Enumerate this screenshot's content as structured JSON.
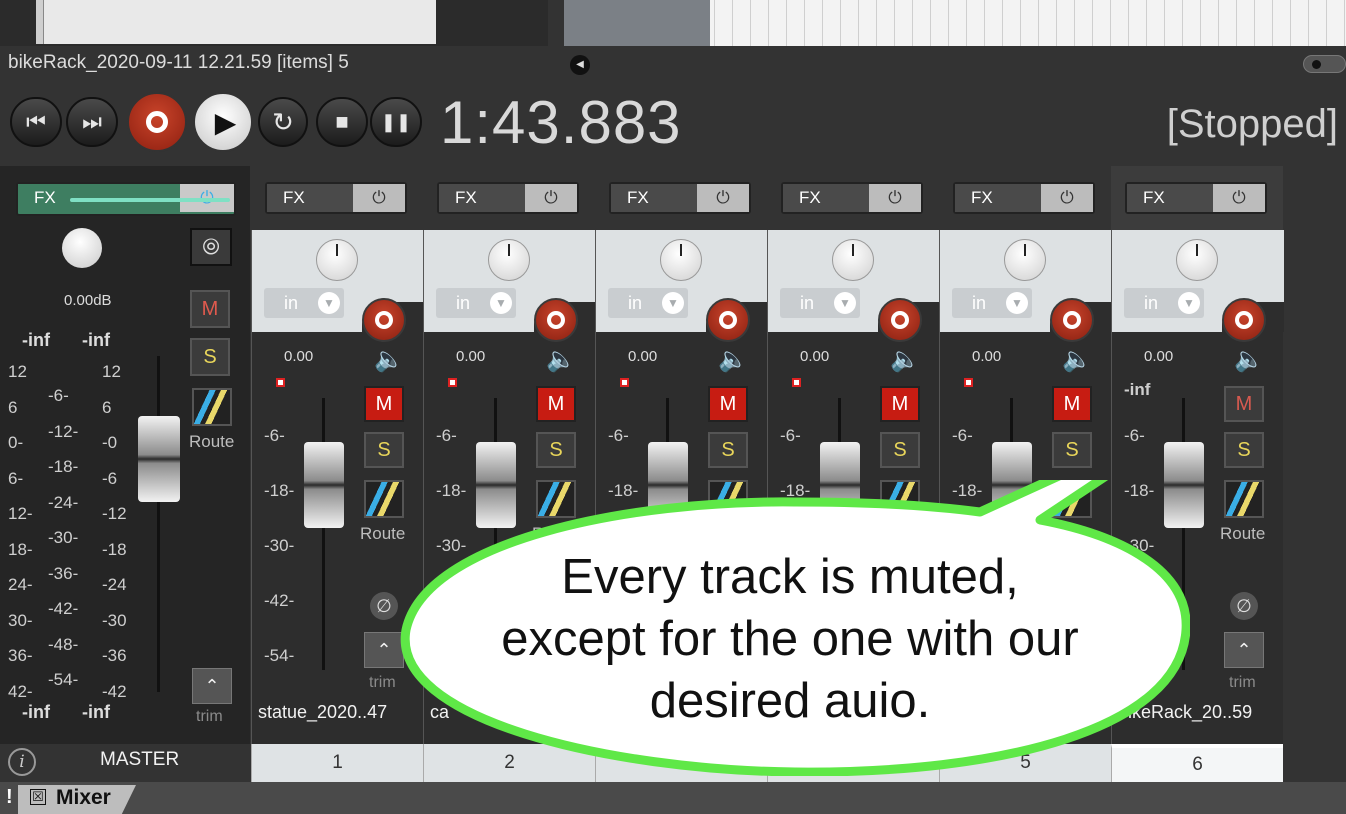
{
  "window": {
    "project_title": "bikeRack_2020-09-11 12.21.59 [items] 5"
  },
  "transport": {
    "time": "1:43.883",
    "status": "[Stopped]",
    "buttons": [
      {
        "name": "go-to-start",
        "icon": "⏮"
      },
      {
        "name": "go-to-end",
        "icon": "⏭"
      },
      {
        "name": "record",
        "icon": "record-icon"
      },
      {
        "name": "play",
        "icon": "▶"
      },
      {
        "name": "repeat",
        "icon": "↻"
      },
      {
        "name": "stop",
        "icon": "■"
      },
      {
        "name": "pause",
        "icon": "❚❚"
      }
    ]
  },
  "master": {
    "fx_label": "FX",
    "power_icon": "⏻",
    "stereo_icon": "⦾",
    "volume": "0.00dB",
    "peak_left": "-inf",
    "peak_right": "-inf",
    "bottom_left": "-inf",
    "bottom_right": "-inf",
    "mute": "M",
    "solo": "S",
    "route": "Route",
    "trim": "trim",
    "label": "MASTER",
    "scale_left": [
      "12",
      "6",
      "0-",
      "6-",
      "12-",
      "18-",
      "24-",
      "30-",
      "36-",
      "42-"
    ],
    "scale_mid": [
      "-6-",
      "-12-",
      "-18-",
      "-24-",
      "-30-",
      "-36-",
      "-42-",
      "-48-",
      "-54-"
    ],
    "scale_right": [
      "12",
      "6",
      "-0",
      "-6",
      "-12",
      "-18",
      "-24",
      "-30",
      "-36",
      "-42"
    ]
  },
  "strip_common": {
    "fx_label": "FX",
    "power_icon": "⏻",
    "input": "in",
    "volume": "0.00",
    "mute": "M",
    "solo": "S",
    "route": "Route",
    "trim": "trim",
    "phase_icon": "∅",
    "scale": [
      "-6-",
      "-18-",
      "-30-",
      "-42-",
      "-54-"
    ]
  },
  "tracks": [
    {
      "number": "1",
      "name": "statue_2020..47",
      "muted": true
    },
    {
      "number": "2",
      "name": "ca",
      "muted": true
    },
    {
      "number": "",
      "name": "",
      "muted": true
    },
    {
      "number": "",
      "name": "",
      "muted": true
    },
    {
      "number": "5",
      "name": "",
      "muted": true
    },
    {
      "number": "6",
      "name": "bikeRack_20..59",
      "muted": false,
      "peak": "-inf",
      "selected": true
    }
  ],
  "bottom": {
    "bang": "!",
    "tab_label": "Mixer",
    "tab_close": "☒"
  },
  "callout": {
    "lines": [
      "Every track is muted,",
      "except for the one with our",
      "desired auio."
    ],
    "fill_color": "#ffffff",
    "border_color": "#5fe847"
  },
  "colors": {
    "background": "#333333",
    "mute_active": "#c71c12",
    "record": "#b53a22",
    "master_fx": "#3e7e61"
  }
}
